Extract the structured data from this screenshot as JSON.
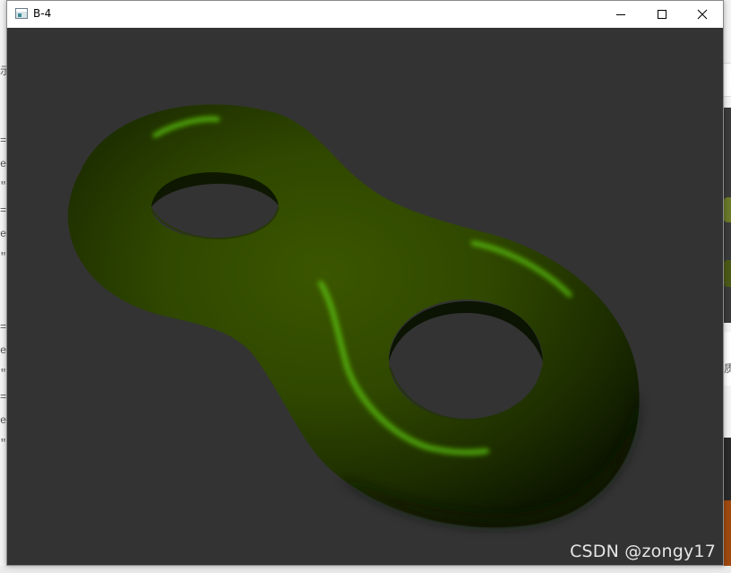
{
  "window": {
    "title": "B-4",
    "minimize_label": "Minimize",
    "maximize_label": "Maximize",
    "close_label": "Close"
  },
  "viewport": {
    "background_color": "#333333",
    "object": "double-torus",
    "object_color": "#2f4a00",
    "highlight_color": "#5fd010"
  },
  "watermark": {
    "text": "CSDN @zongy17"
  },
  "background_fragments": {
    "left": [
      "示",
      "=\"",
      "e",
      "\"",
      "=\"",
      "e",
      "\"",
      "=\"",
      "e",
      "\"",
      "=\"",
      "e",
      "\""
    ],
    "right": [
      "质"
    ]
  }
}
